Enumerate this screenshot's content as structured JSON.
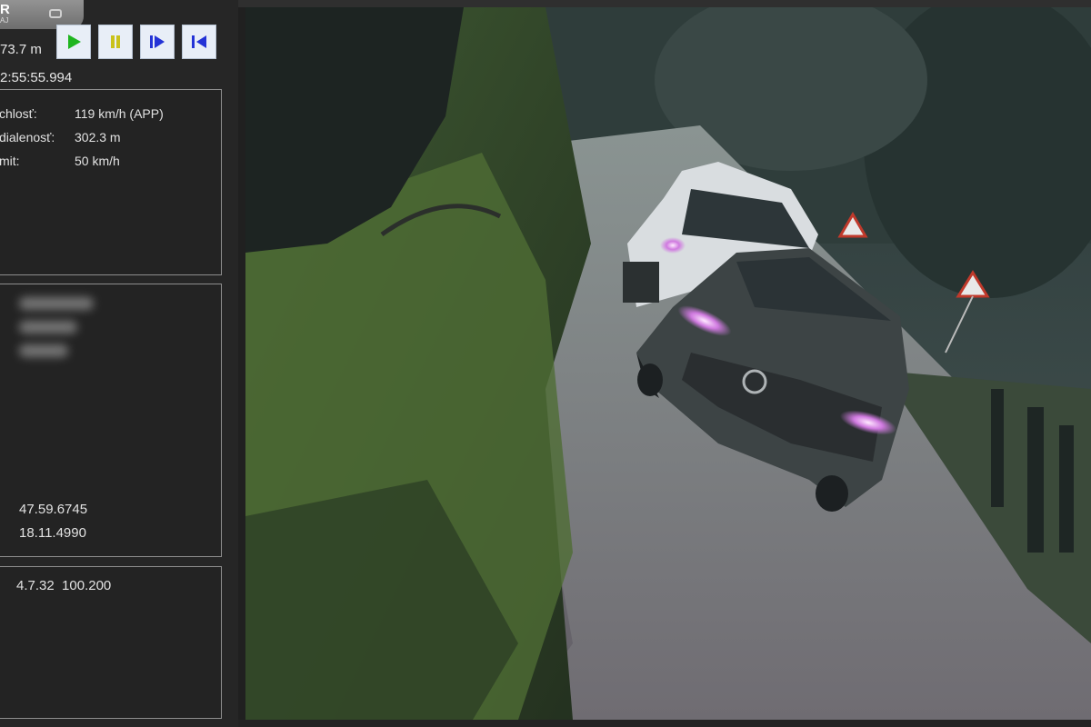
{
  "app": {
    "logo_text": "R",
    "logo_sub": "AJ"
  },
  "readout": {
    "distance": "73.7 m",
    "time": "2:55:55.994"
  },
  "controls": {
    "play": "play-icon",
    "pause": "pause-icon",
    "step_forward": "step-forward-icon",
    "skip_start": "skip-to-start-icon",
    "colors": {
      "play": "#1fb51f",
      "pause": "#c9c21a",
      "step": "#2433d6"
    }
  },
  "measurement": {
    "speed_label": "chlosť:",
    "speed_value": "119 km/h (APP)",
    "distance_label": "dialenosť:",
    "distance_value": "302.3 m",
    "limit_label": "mit:",
    "limit_value": "50 km/h"
  },
  "location": {
    "latitude": "47.59.6745",
    "longitude": "18.11.4990"
  },
  "device": {
    "version": "4.7.32  100.200"
  }
}
